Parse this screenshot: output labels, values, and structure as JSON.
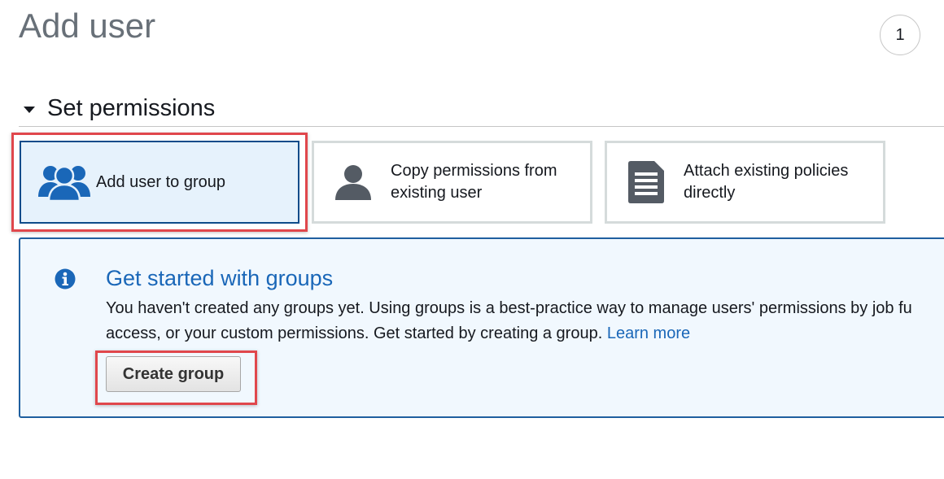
{
  "page": {
    "title": "Add user",
    "step_number": "1"
  },
  "section": {
    "title": "Set permissions"
  },
  "options": [
    {
      "label": "Add user to group",
      "icon": "user-group-icon",
      "selected": true
    },
    {
      "label": "Copy permissions from existing user",
      "line1": "Copy permissions from",
      "line2": "existing user",
      "icon": "user-icon",
      "selected": false
    },
    {
      "label": "Attach existing policies directly",
      "line1": "Attach existing policies",
      "line2": "directly",
      "icon": "document-icon",
      "selected": false
    }
  ],
  "info": {
    "icon": "info-icon",
    "title": "Get started with groups",
    "line1": "You haven't created any groups yet. Using groups is a best-practice way to manage users' permissions by job fu",
    "line2_prefix": "access, or your custom permissions. Get started by creating a group. ",
    "learn_more": "Learn more",
    "button_label": "Create group"
  },
  "colors": {
    "accent_blue": "#1a67b8",
    "selected_border": "#0e4c8a",
    "selected_bg": "#e6f2fc",
    "info_bg": "#f1f8fe",
    "highlight_red": "#e0474c",
    "icon_gray": "#545b64"
  }
}
